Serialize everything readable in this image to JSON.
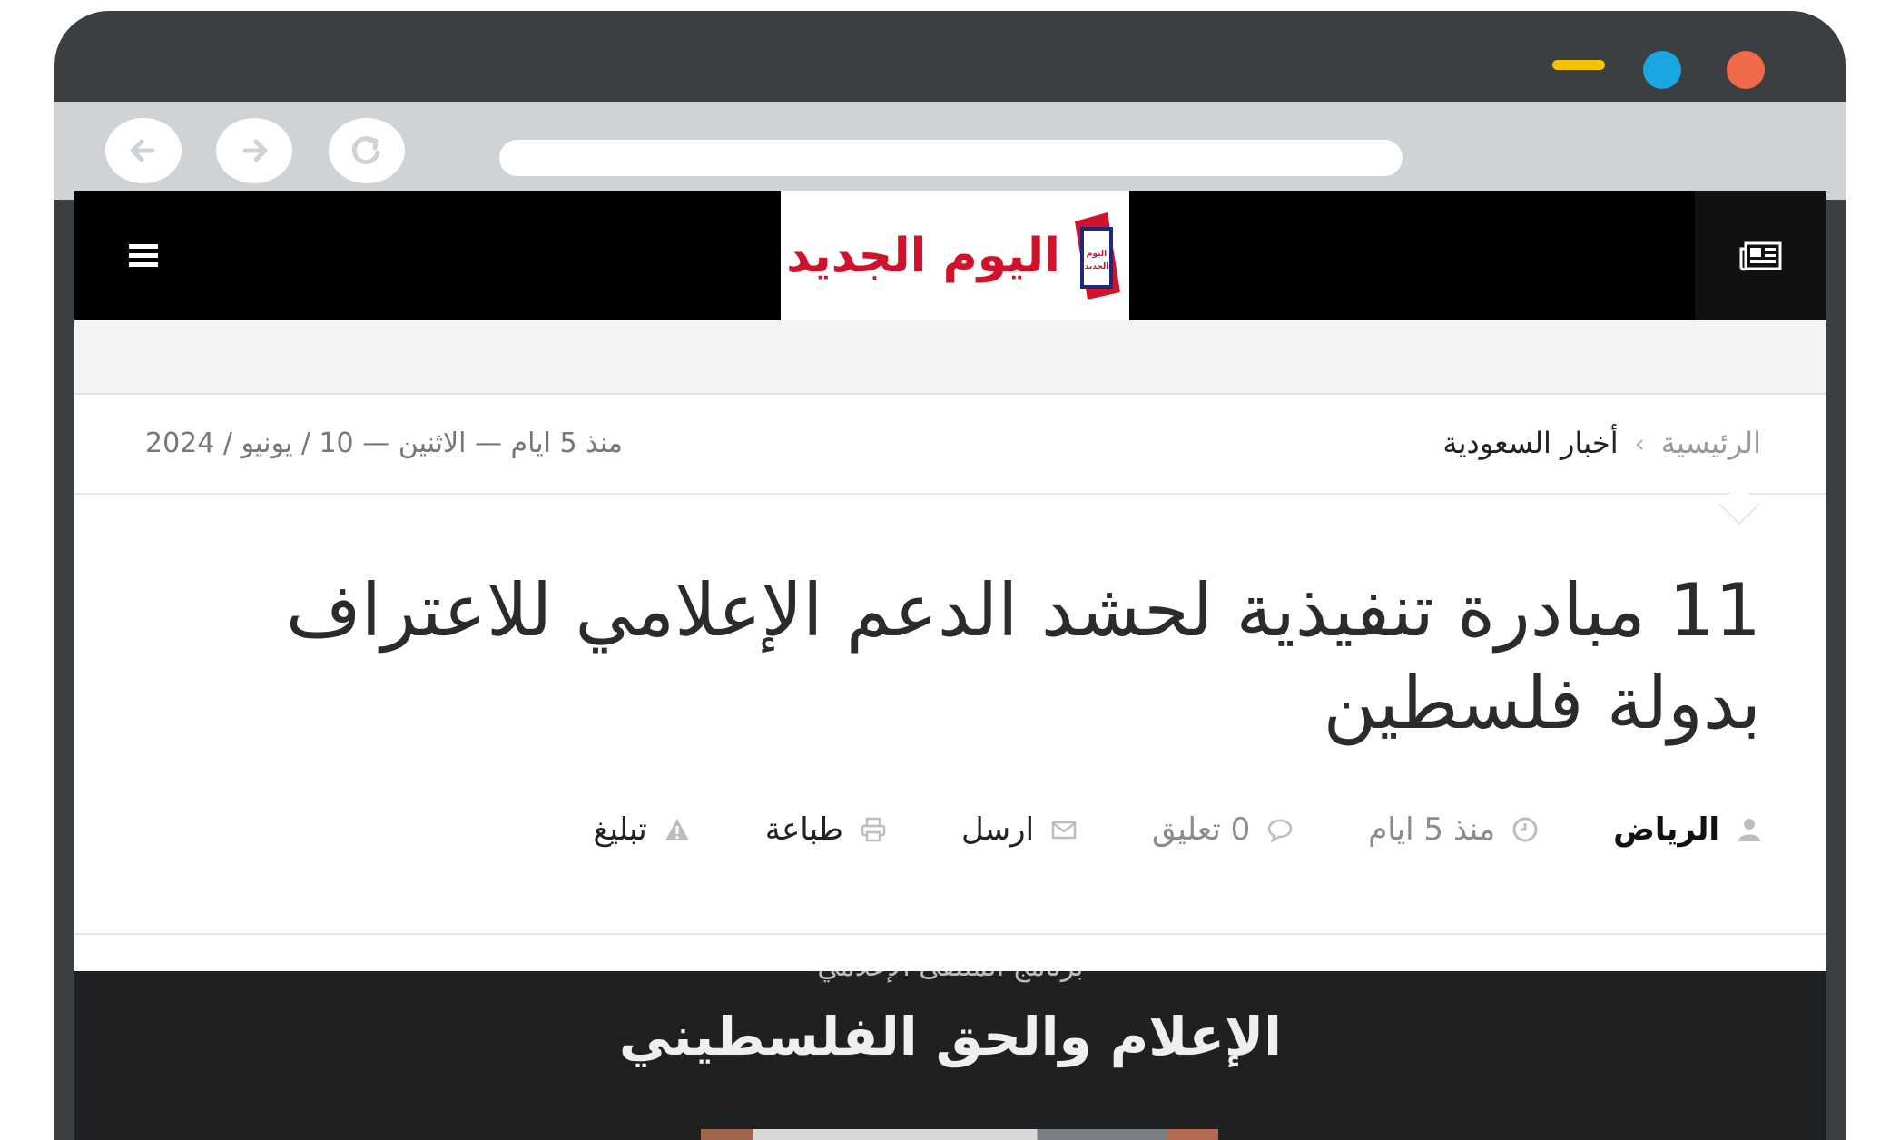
{
  "browser": {
    "window_controls": [
      "minimize",
      "maximize",
      "close"
    ],
    "nav": {
      "back_icon": "arrow-left-icon",
      "forward_icon": "arrow-right-icon",
      "reload_icon": "reload-icon"
    },
    "address_bar": {
      "value": ""
    },
    "colors": {
      "minimize": "#f5c400",
      "maximize": "#1aa6e0",
      "close": "#f06a4a",
      "frame": "#3b3f42"
    }
  },
  "site": {
    "logo_text": "اليوم الجديد",
    "logo_mark_text": "اليوم الجديد",
    "menu_icon": "hamburger-menu-icon",
    "news_icon": "newspaper-icon",
    "brand_color": "#d0122a"
  },
  "breadcrumb": {
    "home": "الرئيسية",
    "separator": "›",
    "current": "أخبار السعودية"
  },
  "date_line": "منذ 5 ايام — الاثنين — 10 / يونيو / 2024",
  "article": {
    "title": "11 مبادرة تنفيذية لحشد الدعم الإعلامي للاعتراف بدولة فلسطين",
    "meta": {
      "author": "الرياض",
      "time": "منذ 5 ايام",
      "comments": "0 تعليق",
      "send": "ارسل",
      "print": "طباعة",
      "report": "تبليغ"
    }
  },
  "hero": {
    "subtitle": "برنامج الملتقى الإعلامي",
    "title": "الإعلام والحق الفلسطيني"
  }
}
